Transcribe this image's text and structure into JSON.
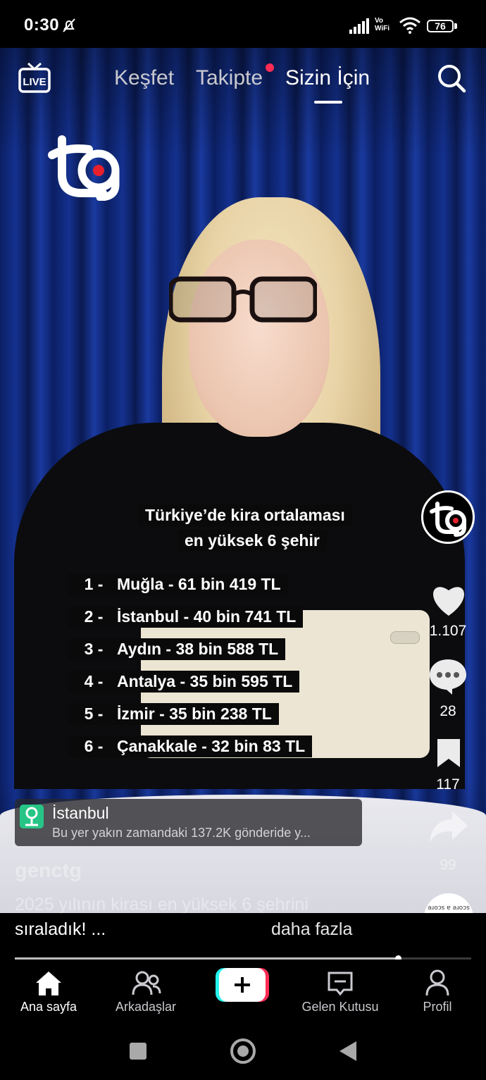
{
  "status_bar": {
    "time": "0:30",
    "network_label": "Vo WiFi",
    "battery": "76"
  },
  "top_nav": {
    "tabs": [
      {
        "label": "Keşfet"
      },
      {
        "label": "Takipte"
      },
      {
        "label": "Sizin İçin"
      }
    ],
    "active_tab": "Sizin İçin"
  },
  "video_overlay": {
    "title_line1": "Türkiye’de kira ortalaması",
    "title_line2": "en yüksek 6 şehir",
    "ranking": [
      {
        "rank": "1 -",
        "text": "Muğla - 61 bin 419 TL"
      },
      {
        "rank": "2 -",
        "text": "İstanbul - 40 bin 741 TL"
      },
      {
        "rank": "3 -",
        "text": "Aydın - 38 bin 588 TL"
      },
      {
        "rank": "4 -",
        "text": "Antalya - 35 bin 595 TL"
      },
      {
        "rank": "5 -",
        "text": "İzmir - 35 bin 238 TL"
      },
      {
        "rank": "6 -",
        "text": "Çanakkale - 32 bin 83 TL"
      }
    ]
  },
  "right_rail": {
    "likes": "1.107",
    "comments": "28",
    "bookmarks": "117",
    "shares": "99"
  },
  "location": {
    "title": "İstanbul",
    "subtitle": "Bu yer yakın zamandaki 137.2K gönderide y..."
  },
  "post": {
    "username": "genctg",
    "caption_line1": "2025 yılının kirası en yüksek 6 şehrini",
    "caption_line2": "sıraladık! ...",
    "more": "daha fazla"
  },
  "music": {
    "label": "score a score"
  },
  "progress": {
    "fraction": 0.84
  },
  "bottom_nav": {
    "home": "Ana sayfa",
    "friends": "Arkadaşlar",
    "inbox": "Gelen Kutusu",
    "profile": "Profil"
  },
  "colors": {
    "accent": "#fe2c55",
    "cyan": "#25f4ee",
    "location_green": "#26c586"
  }
}
